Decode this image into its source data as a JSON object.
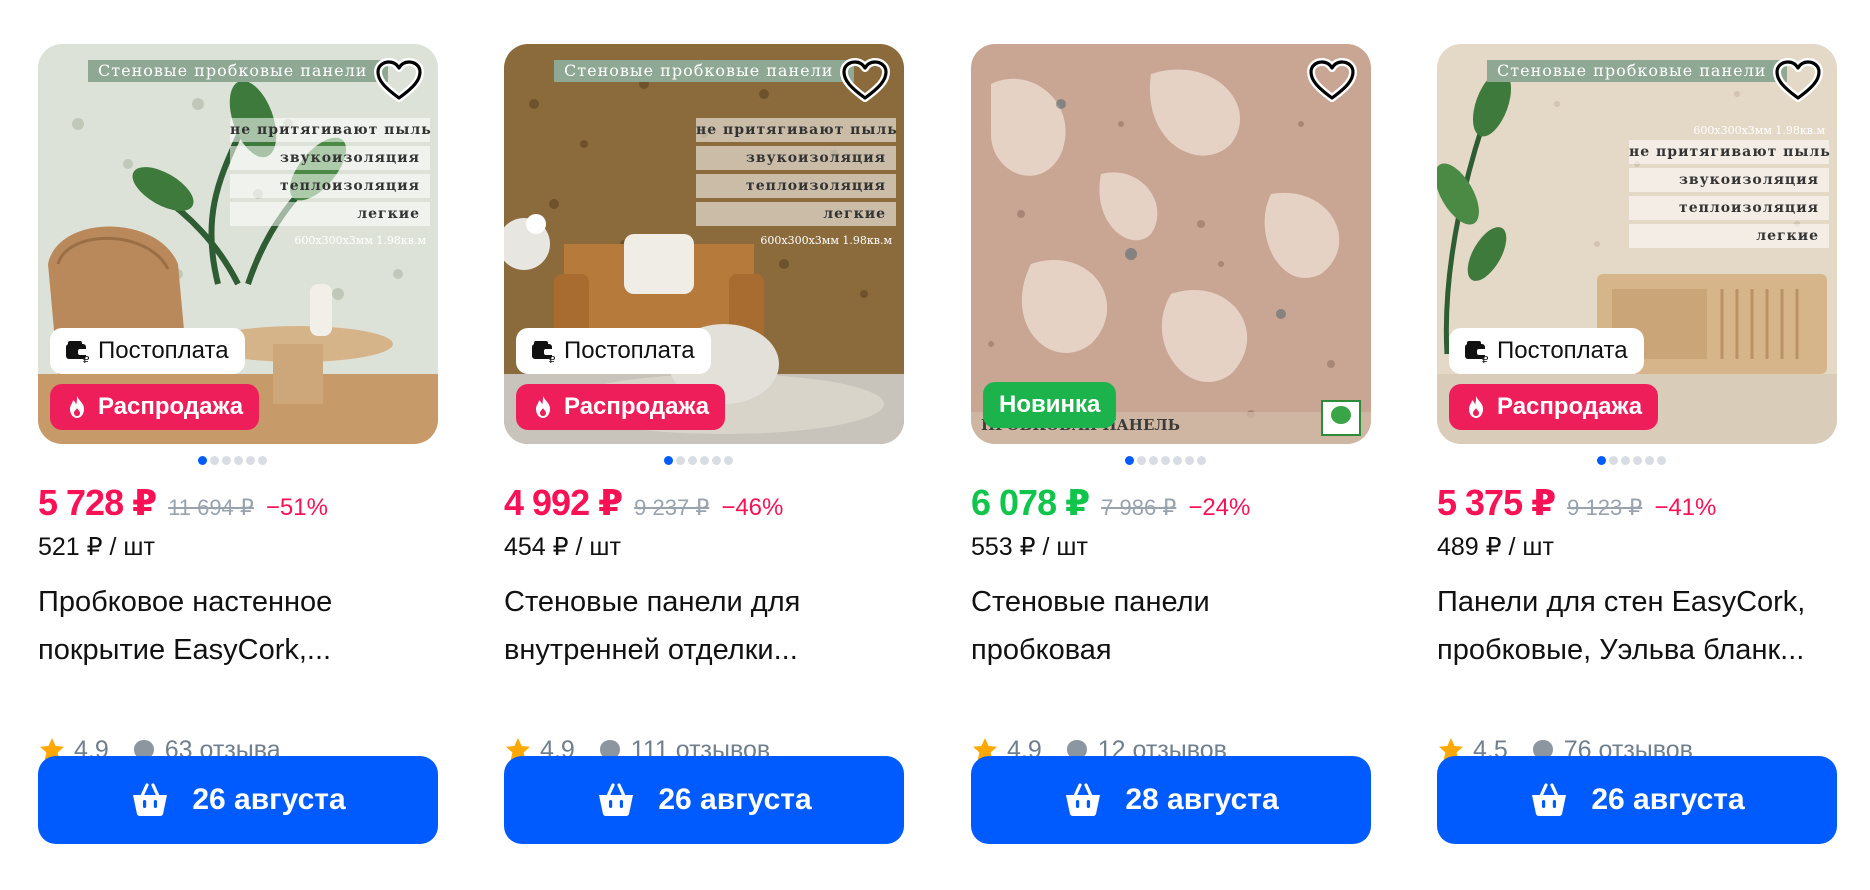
{
  "colors": {
    "accent": "#005bff",
    "sale": "#f91155",
    "new": "#10c44c",
    "muted": "#707f8d"
  },
  "icons": [
    "heart-icon",
    "wallet-icon",
    "fire-icon",
    "star-icon",
    "chat-bubble-icon",
    "basket-icon"
  ],
  "products": [
    {
      "image": {
        "banner": "Стеновые пробковые панели",
        "features": [
          "не притягивают пыль",
          "звукоизоляция",
          "теплоизоляция",
          "легкие"
        ],
        "size": "600x300x3мм  1.98кв.м"
      },
      "badges": {
        "postpay": "Постоплата",
        "sale": "Распродажа"
      },
      "price": "5 728 ₽",
      "old_price": "11 694 ₽",
      "discount": "−51%",
      "unit_price": "521 ₽ / шт",
      "title_lines": [
        "Пробковое настенное",
        "покрытие EasyCork,..."
      ],
      "rating": "4.9",
      "reviews": "63 отзыва",
      "delivery": "26 августа"
    },
    {
      "image": {
        "banner": "Стеновые пробковые панели",
        "features": [
          "не притягивают пыль",
          "звукоизоляция",
          "теплоизоляция",
          "легкие"
        ],
        "size": "600x300x3мм  1.98кв.м"
      },
      "badges": {
        "postpay": "Постоплата",
        "sale": "Распродажа"
      },
      "price": "4 992 ₽",
      "old_price": "9 237 ₽",
      "discount": "−46%",
      "unit_price": "454 ₽ / шт",
      "title_lines": [
        "Стеновые панели для",
        "внутренней отделки..."
      ],
      "rating": "4.9",
      "reviews": "111 отзывов",
      "delivery": "26 августа"
    },
    {
      "image": {
        "bottom_text": "ПРОБКОВАЯ ПАНЕЛЬ"
      },
      "badges": {
        "new": "Новинка"
      },
      "price": "6 078 ₽",
      "old_price": "7 986 ₽",
      "discount": "−24%",
      "unit_price": "553 ₽ / шт",
      "title_lines": [
        "Стеновые панели",
        "пробковая"
      ],
      "rating": "4.9",
      "reviews": "12 отзывов",
      "delivery": "28 августа"
    },
    {
      "image": {
        "banner": "Стеновые пробковые панели",
        "features": [
          "не притягивают пыль",
          "звукоизоляция",
          "теплоизоляция",
          "легкие"
        ],
        "size": "600x300x3мм  1.98кв.м"
      },
      "badges": {
        "postpay": "Постоплата",
        "sale": "Распродажа"
      },
      "price": "5 375 ₽",
      "old_price": "9 123 ₽",
      "discount": "−41%",
      "unit_price": "489 ₽ / шт",
      "title_lines": [
        "Панели для стен EasyCork,",
        "пробковые, Уэльва бланк..."
      ],
      "rating": "4.5",
      "reviews": "76 отзывов",
      "delivery": "26 августа"
    }
  ]
}
